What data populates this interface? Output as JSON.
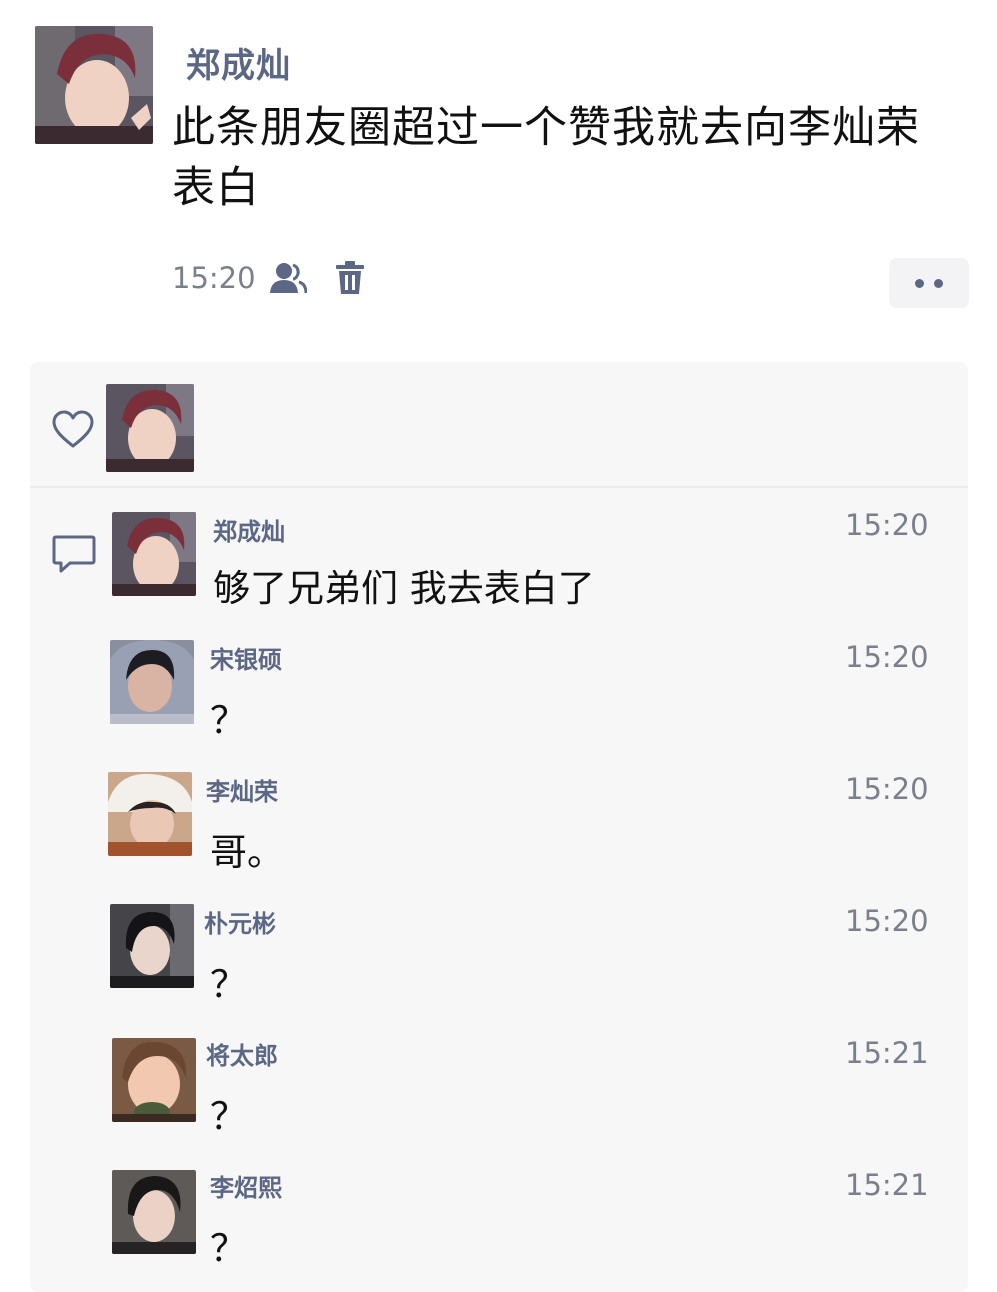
{
  "post": {
    "author": "郑成灿",
    "text": "此条朋友圈超过一个赞我就去向李灿荣表白",
    "time": "15:20",
    "icons": [
      "friends-icon",
      "trash-icon",
      "more-dots-icon"
    ]
  },
  "likes": {
    "icon": "heart-icon"
  },
  "comments": [
    {
      "name": "郑成灿",
      "text": "够了兄弟们 我去表白了",
      "time": "15:20"
    },
    {
      "name": "宋银硕",
      "text": "？",
      "time": "15:20"
    },
    {
      "name": "李灿荣",
      "text": "哥。",
      "time": "15:20"
    },
    {
      "name": "朴元彬",
      "text": "？",
      "time": "15:20"
    },
    {
      "name": "将太郎",
      "text": "？",
      "time": "15:21"
    },
    {
      "name": "李炤熙",
      "text": "？",
      "time": "15:21"
    }
  ],
  "colors": {
    "name_color": "#5b6785",
    "meta_color": "#7a7f8c",
    "panel_bg": "#f7f7f7"
  }
}
